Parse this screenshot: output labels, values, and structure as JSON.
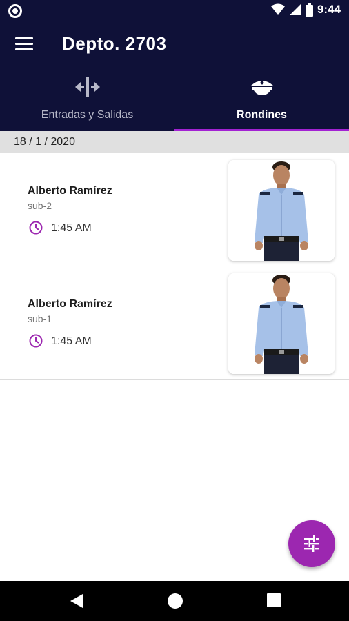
{
  "status_bar": {
    "time": "9:44"
  },
  "app_bar": {
    "title": "Depto. 2703"
  },
  "tabs": [
    {
      "label": "Entradas y Salidas",
      "icon": "entries-exits-icon",
      "active": false
    },
    {
      "label": "Rondines",
      "icon": "guard-cap-icon",
      "active": true
    }
  ],
  "date_header": "18 / 1 / 2020",
  "rounds": [
    {
      "name": "Alberto Ramírez",
      "sub": "sub-2",
      "time": "1:45 AM"
    },
    {
      "name": "Alberto Ramírez",
      "sub": "sub-1",
      "time": "1:45 AM"
    }
  ],
  "colors": {
    "primary": "#0f1138",
    "accent": "#9c27b0",
    "indicator": "#a322d3"
  },
  "fab": {
    "icon": "filter-sliders-icon"
  },
  "nav": {
    "back": "back-icon",
    "home": "home-icon",
    "recents": "recents-icon"
  }
}
